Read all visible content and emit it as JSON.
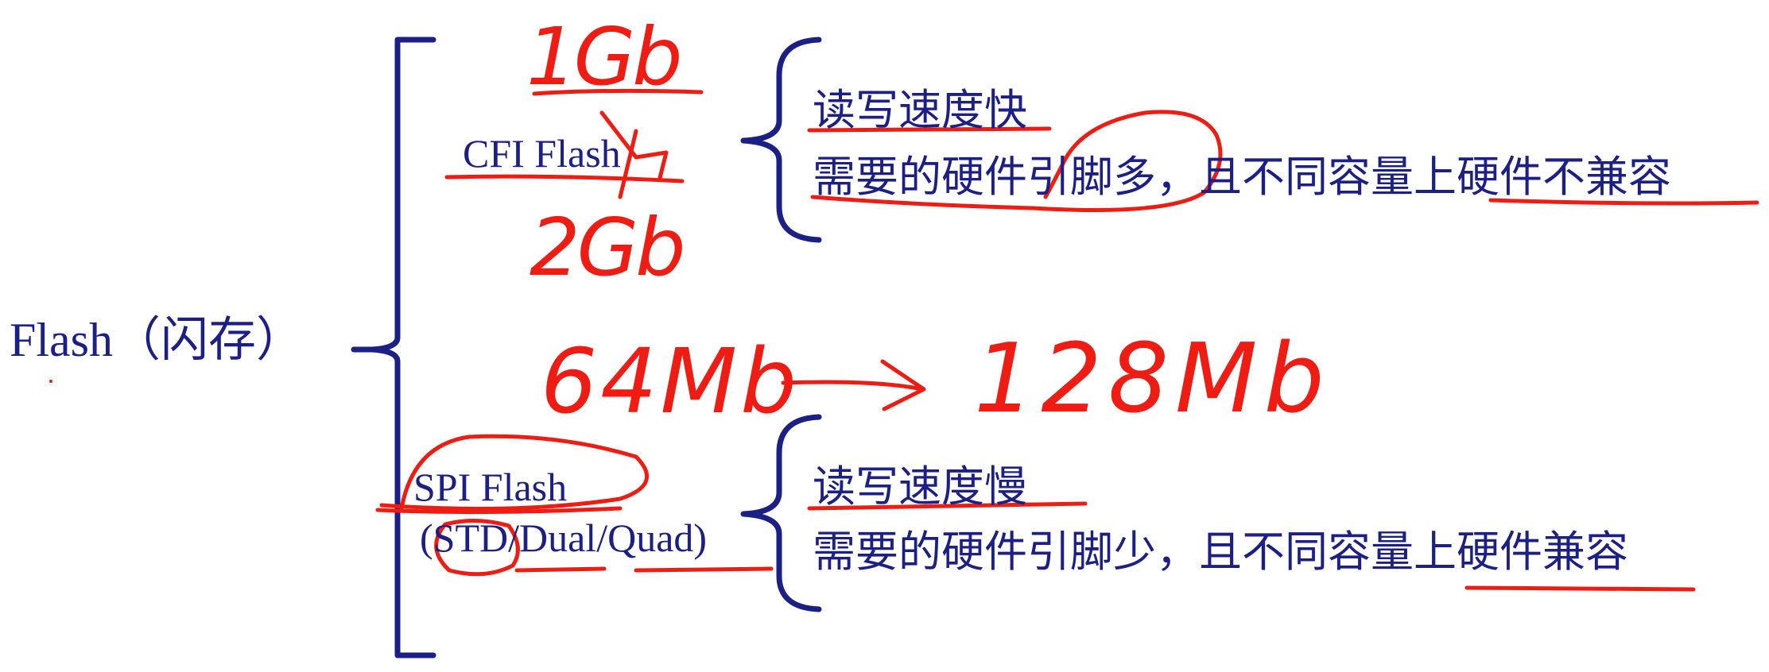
{
  "root": {
    "label": "Flash",
    "label_cn": "（闪存）"
  },
  "branches": [
    {
      "name": "CFI Flash",
      "properties": [
        "读写速度快",
        "需要的硬件引脚多，且不同容量上硬件不兼容"
      ]
    },
    {
      "name": "SPI Flash",
      "modes": "(STD/Dual/Quad)",
      "properties": [
        "读写速度慢",
        "需要的硬件引脚少，且不同容量上硬件兼容"
      ]
    }
  ],
  "annotations": {
    "cfi_capacity_top": "1Gb",
    "cfi_capacity_bottom": "2Gb",
    "spi_capacity_from": "64Mb",
    "spi_capacity_to": "128Mb"
  },
  "colors": {
    "print": "#1c1f86",
    "ink": "#ee1c12",
    "background": "#ffffff"
  }
}
